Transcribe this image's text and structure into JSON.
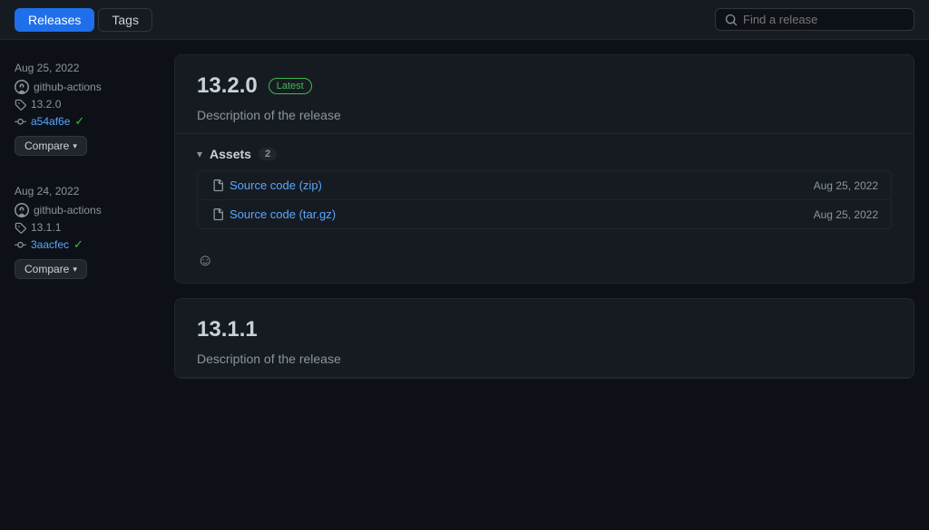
{
  "header": {
    "tabs": [
      {
        "id": "releases",
        "label": "Releases",
        "active": true
      },
      {
        "id": "tags",
        "label": "Tags",
        "active": false
      }
    ],
    "search_placeholder": "Find a release"
  },
  "releases": [
    {
      "id": "r1",
      "date": "Aug 25, 2022",
      "actor": "github-actions",
      "tag": "13.2.0",
      "commit": "a54af6e",
      "verified": true,
      "compare_label": "Compare",
      "version": "13.2.0",
      "is_latest": true,
      "latest_label": "Latest",
      "description": "Description of the release",
      "assets_label": "Assets",
      "assets_count": "2",
      "assets": [
        {
          "name": "Source code (zip)",
          "date": "Aug 25, 2022"
        },
        {
          "name": "Source code (tar.gz)",
          "date": "Aug 25, 2022"
        }
      ]
    },
    {
      "id": "r2",
      "date": "Aug 24, 2022",
      "actor": "github-actions",
      "tag": "13.1.1",
      "commit": "3aacfec",
      "verified": true,
      "compare_label": "Compare",
      "version": "13.1.1",
      "is_latest": false,
      "latest_label": "",
      "description": "Description of the release",
      "assets_label": "",
      "assets_count": "",
      "assets": []
    }
  ]
}
